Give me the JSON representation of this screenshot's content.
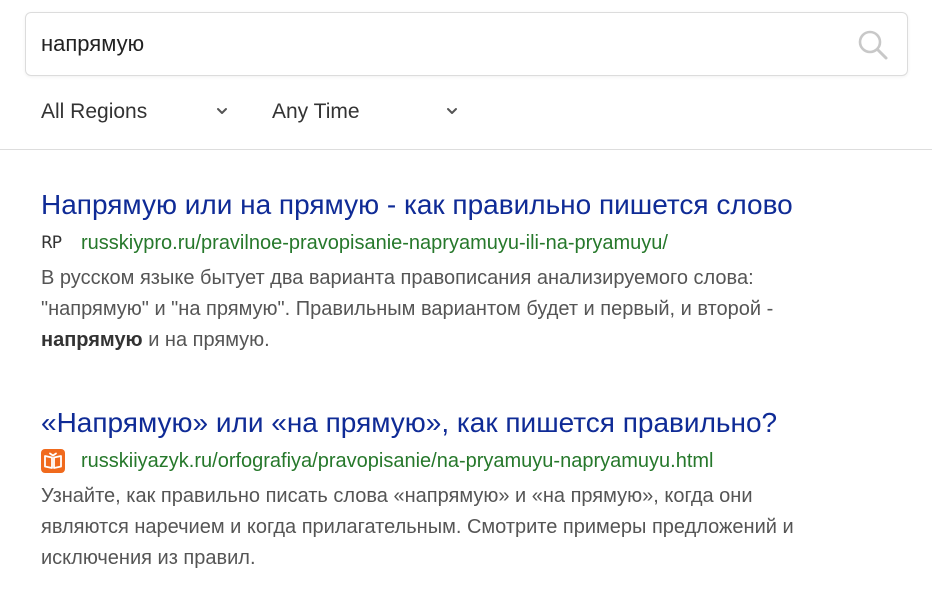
{
  "search": {
    "query": "напрямую",
    "icon": "search-icon"
  },
  "filters": {
    "region": "All Regions",
    "time": "Any Time"
  },
  "results": [
    {
      "title": "Напрямую или на прямую - как правильно пишется слово",
      "favicon_text": "RP",
      "url": "russkiypro.ru/pravilnoe-pravopisanie-napryamuyu-ili-na-pryamuyu/",
      "snippet_line1": "В русском языке бытует два варианта правописания анализируемого слова:",
      "snippet_line2": "\"напрямую\" и \"на прямую\". Правильным вариантом будет и первый, и второй -",
      "snippet_bold": "напрямую",
      "snippet_tail": " и на прямую."
    },
    {
      "title": "«Напрямую» или «на прямую», как пишется правильно?",
      "favicon_icon": "open-book-icon",
      "url": "russkiiyazyk.ru/orfografiya/pravopisanie/na-pryamuyu-napryamuyu.html",
      "snippet_line1": "Узнайте, как правильно писать слова «напрямую» и «на прямую», когда они",
      "snippet_line2": "являются наречием и когда прилагательным. Смотрите примеры предложений и",
      "snippet_line3": "исключения из правил."
    }
  ],
  "colors": {
    "title": "#0f2b96",
    "url": "#26782b",
    "snippet": "#555555",
    "favicon_orange": "#f06a1d"
  }
}
